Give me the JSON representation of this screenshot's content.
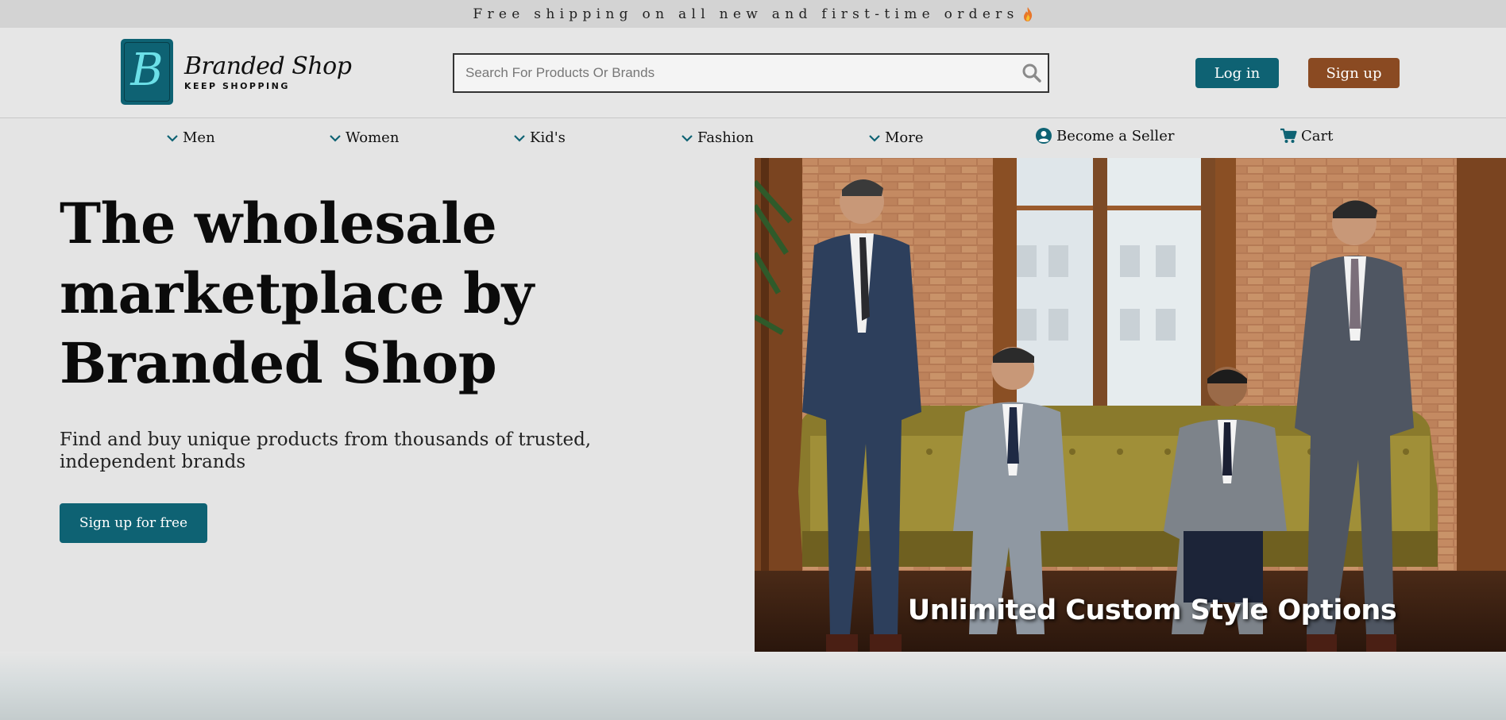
{
  "promo": {
    "text": "Free shipping on all new and first-time orders"
  },
  "brand": {
    "name": "Branded Shop",
    "tagline": "KEEP SHOPPING",
    "logo_letter": "B"
  },
  "search": {
    "placeholder": "Search For Products Or Brands"
  },
  "auth": {
    "login_label": "Log in",
    "signup_label": "Sign up"
  },
  "nav": {
    "items": [
      {
        "label": "Men"
      },
      {
        "label": "Women"
      },
      {
        "label": "Kid's"
      },
      {
        "label": "Fashion"
      },
      {
        "label": "More"
      }
    ],
    "seller_label": "Become a Seller",
    "cart_label": "Cart"
  },
  "hero": {
    "title_line1": "The wholesale",
    "title_line2": "marketplace by",
    "title_line3": "Branded Shop",
    "subtitle_line1": "Find and buy unique products from thousands of trusted,",
    "subtitle_line2": "independent brands",
    "cta_label": "Sign up for free",
    "image_caption": "Unlimited Custom Style Options"
  },
  "colors": {
    "teal": "#0e6273",
    "brown": "#8a4a22",
    "background": "#e4e4e4"
  }
}
